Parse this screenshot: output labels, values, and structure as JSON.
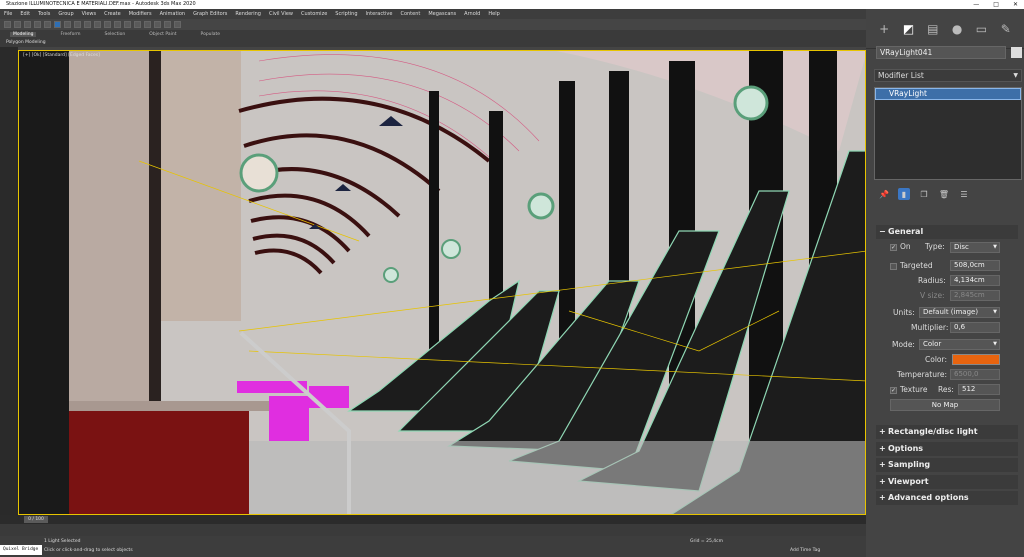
{
  "window": {
    "title": "Stazione ILLUMINOTECNICA E MATERIALI.DEF.max - Autodesk 3ds Max 2020"
  },
  "menu": [
    "File",
    "Edit",
    "Tools",
    "Group",
    "Views",
    "Create",
    "Modifiers",
    "Animation",
    "Graph Editors",
    "Rendering",
    "Civil View",
    "Customize",
    "Scripting",
    "Interactive",
    "Content",
    "Megascans",
    "Arnold",
    "Help"
  ],
  "ribbon": {
    "tabs": [
      "Modeling",
      "Freeform",
      "Selection",
      "Object Paint",
      "Populate"
    ],
    "sub": "Polygon Modeling"
  },
  "viewport": {
    "label": "[+] [Ok] [Standard] [Edged Faces]"
  },
  "cmd": {
    "object_name": "VRayLight041",
    "modifier_list": "Modifier List",
    "stack_item": "VRayLight",
    "general": {
      "title": "General",
      "on_label": "On",
      "type_label": "Type:",
      "type_value": "Disc",
      "targeted_label": "Targeted",
      "targeted_value": "508,0cm",
      "radius_label": "Radius:",
      "radius_value": "4,134cm",
      "vsize_label": "V size:",
      "vsize_value": "2,845cm",
      "units_label": "Units:",
      "units_value": "Default (image)",
      "mult_label": "Multiplier:",
      "mult_value": "0,6",
      "mode_label": "Mode:",
      "mode_value": "Color",
      "color_label": "Color:",
      "color_hex": "#e8640f",
      "temp_label": "Temperature:",
      "temp_value": "6500,0",
      "texture_label": "Texture",
      "res_label": "Res:",
      "res_value": "512",
      "nomap": "No Map"
    },
    "rollouts": [
      "Rectangle/disc light",
      "Options",
      "Sampling",
      "Viewport",
      "Advanced options"
    ]
  },
  "time": {
    "frame": "0 / 100"
  },
  "status": {
    "sel": "1 Light Selected",
    "hint": "Click or click-and-drag to select objects",
    "maxscript": "Quixel Bridge",
    "grid": "Grid = 25,4cm",
    "addtag": "Add Time Tag"
  }
}
